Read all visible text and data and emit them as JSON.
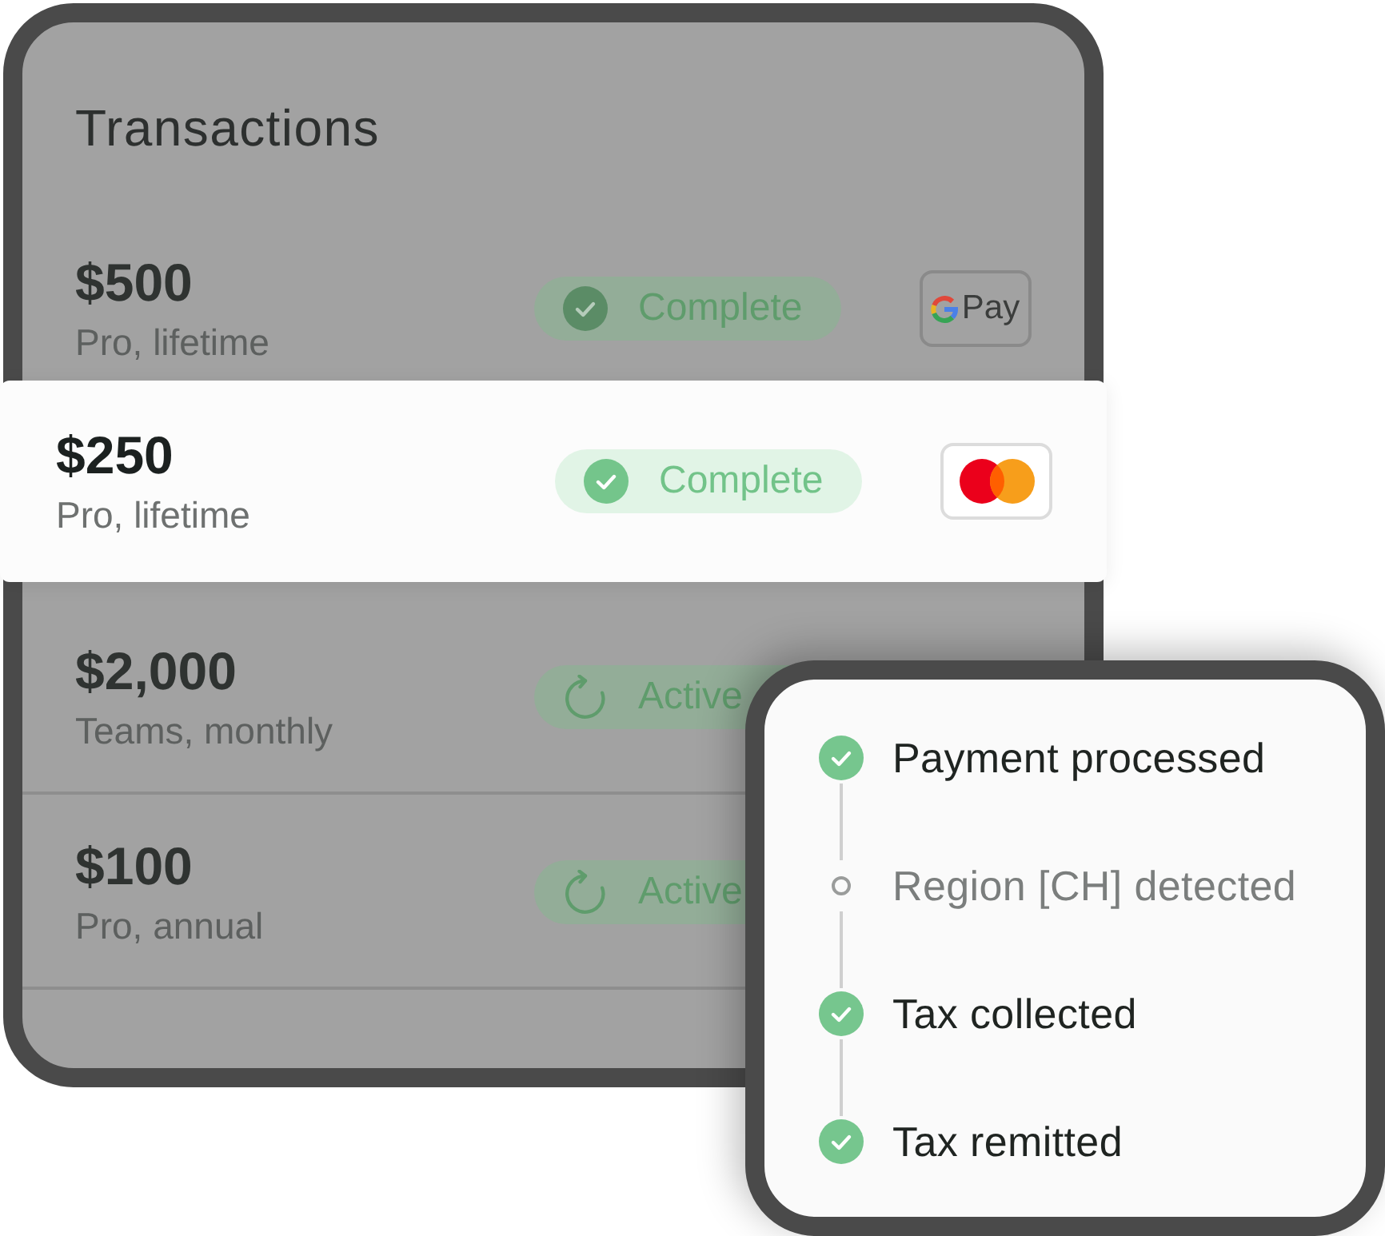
{
  "card": {
    "title": "Transactions"
  },
  "transactions": [
    {
      "amount": "$500",
      "plan": "Pro, lifetime",
      "selected": false,
      "status": {
        "kind": "complete",
        "label": "Complete"
      },
      "method": {
        "kind": "gpay",
        "label": "Pay"
      }
    },
    {
      "amount": "$250",
      "plan": "Pro, lifetime",
      "selected": true,
      "status": {
        "kind": "complete",
        "label": "Complete"
      },
      "method": {
        "kind": "mastercard"
      }
    },
    {
      "amount": "$2,000",
      "plan": "Teams, monthly",
      "selected": false,
      "status": {
        "kind": "active",
        "label": "Active"
      }
    },
    {
      "amount": "$100",
      "plan": "Pro, annual",
      "selected": false,
      "status": {
        "kind": "active",
        "label": "Active"
      }
    }
  ],
  "steps": [
    {
      "label": "Payment processed",
      "completed": true
    },
    {
      "label": "Region [CH] detected",
      "completed": false
    },
    {
      "label": "Tax collected",
      "completed": true
    },
    {
      "label": "Tax remitted",
      "completed": true
    }
  ]
}
